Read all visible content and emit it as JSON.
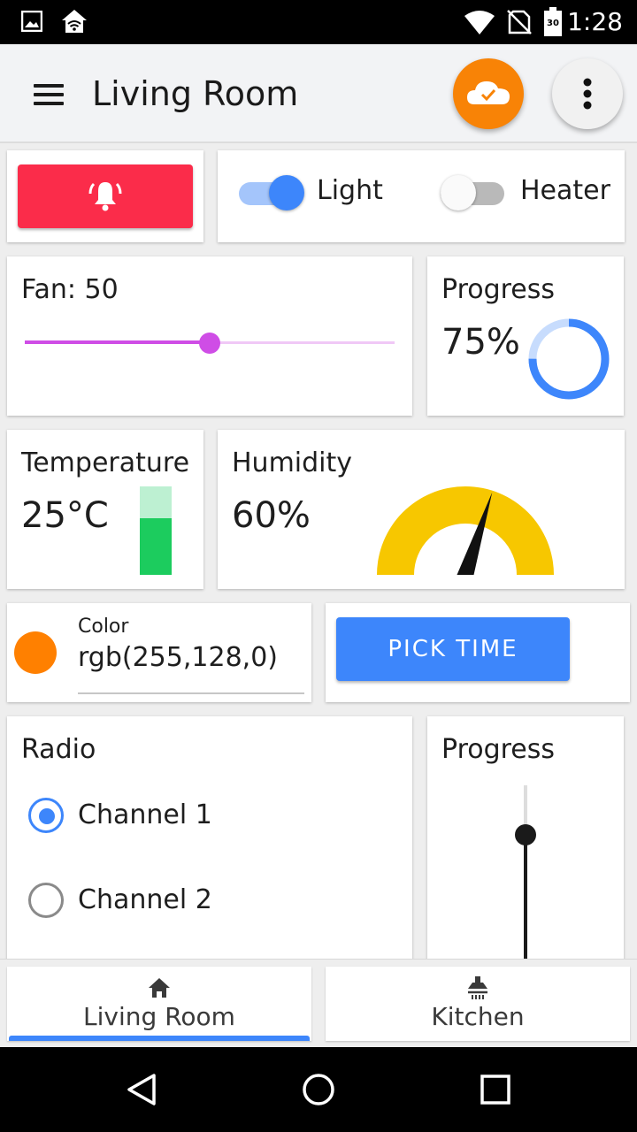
{
  "status_bar": {
    "time": "1:28",
    "battery_level": "30"
  },
  "app_bar": {
    "title": "Living Room"
  },
  "switches": [
    {
      "label": "Light",
      "on": true
    },
    {
      "label": "Heater",
      "on": false
    }
  ],
  "fan": {
    "label": "Fan: 50",
    "value": 50,
    "min": 0,
    "max": 100
  },
  "progress_ring": {
    "label": "Progress",
    "value_text": "75%",
    "value": 0.75
  },
  "temperature": {
    "label": "Temperature",
    "value_text": "25°C",
    "level": 0.64
  },
  "humidity": {
    "label": "Humidity",
    "value_text": "60%",
    "value": 0.6
  },
  "color_field": {
    "label": "Color",
    "value": "rgb(255,128,0)",
    "swatch": "#ff8000"
  },
  "pick_time": {
    "label": "PICK TIME"
  },
  "radio": {
    "label": "Radio",
    "options": [
      {
        "label": "Channel 1",
        "selected": true
      },
      {
        "label": "Channel 2",
        "selected": false
      }
    ]
  },
  "vertical_progress": {
    "label": "Progress"
  },
  "tabs": [
    {
      "label": "Living Room",
      "icon": "home-icon",
      "active": true
    },
    {
      "label": "Kitchen",
      "icon": "range-hood-icon",
      "active": false
    }
  ],
  "colors": {
    "accent": "#3d86fb",
    "alarm": "#fb2c4a",
    "cloud": "#f88306",
    "slider": "#cf4de6",
    "gauge": "#f7c700",
    "thermo": "#1ccc5e"
  }
}
